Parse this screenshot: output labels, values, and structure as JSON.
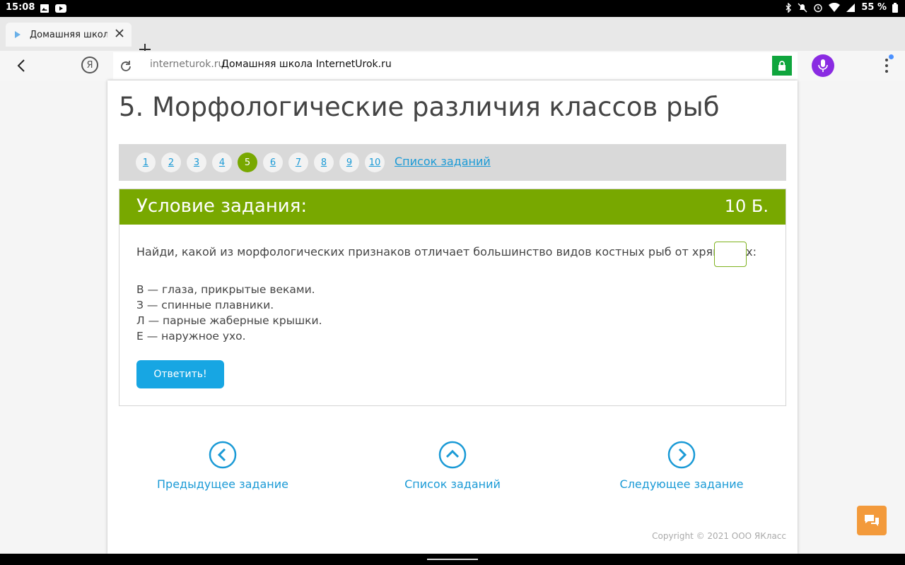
{
  "statusbar": {
    "time": "15:08",
    "battery": "55 %"
  },
  "tab": {
    "title": "Домашняя школа"
  },
  "address": {
    "domain": "interneturok.ru",
    "page_title": "Домашняя школа InternetUrok.ru",
    "ya_label": "Я"
  },
  "page": {
    "heading": "5. Морфологические различия классов рыб",
    "pager": {
      "numbers": [
        "1",
        "2",
        "3",
        "4",
        "5",
        "6",
        "7",
        "8",
        "9",
        "10"
      ],
      "active": "5",
      "tasklist": "Список заданий"
    },
    "task": {
      "label": "Условие задания:",
      "points": "10 Б.",
      "question": "Найди, какой из морфологических признаков отличает большинство видов костных рыб от хрящевых:",
      "answer_value": "",
      "dot": ".",
      "options": [
        "В — глаза, прикрытые веками.",
        "З — спинные плавники.",
        "Л — парные жаберные крышки.",
        "Е — наружное ухо."
      ],
      "submit": "Ответить!"
    },
    "nav": {
      "prev": "Предыдущее задание",
      "list": "Список заданий",
      "next": "Следующее задание"
    },
    "copyright": "Copyright © 2021 ООО ЯКласс"
  },
  "colors": {
    "accent_green": "#78a800",
    "link_blue": "#1a9ad6",
    "button_blue": "#17a6e3",
    "chat_orange": "#f39a3b"
  }
}
